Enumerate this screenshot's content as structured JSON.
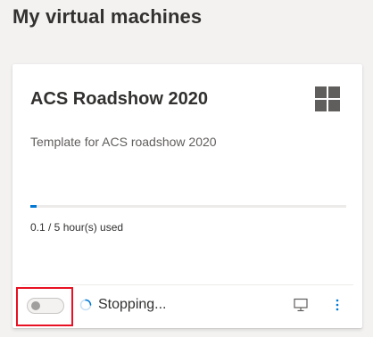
{
  "page": {
    "title": "My virtual machines"
  },
  "vm_card": {
    "name": "ACS Roadshow 2020",
    "description": "Template for ACS roadshow 2020",
    "os_icon": "windows-logo-icon",
    "usage": {
      "used_hours": 0.1,
      "quota_hours": 5,
      "progress_fraction": 0.02,
      "label": "0.1 / 5 hour(s) used"
    },
    "status": {
      "text": "Stopping...",
      "icon": "spinner-icon",
      "toggle_on": false
    },
    "actions": {
      "connect_icon": "monitor-icon",
      "more_icon": "more-vertical-icon"
    }
  },
  "colors": {
    "accent": "#0078d4",
    "highlight_border": "#e81123",
    "background": "#f3f2f1",
    "card": "#ffffff"
  }
}
